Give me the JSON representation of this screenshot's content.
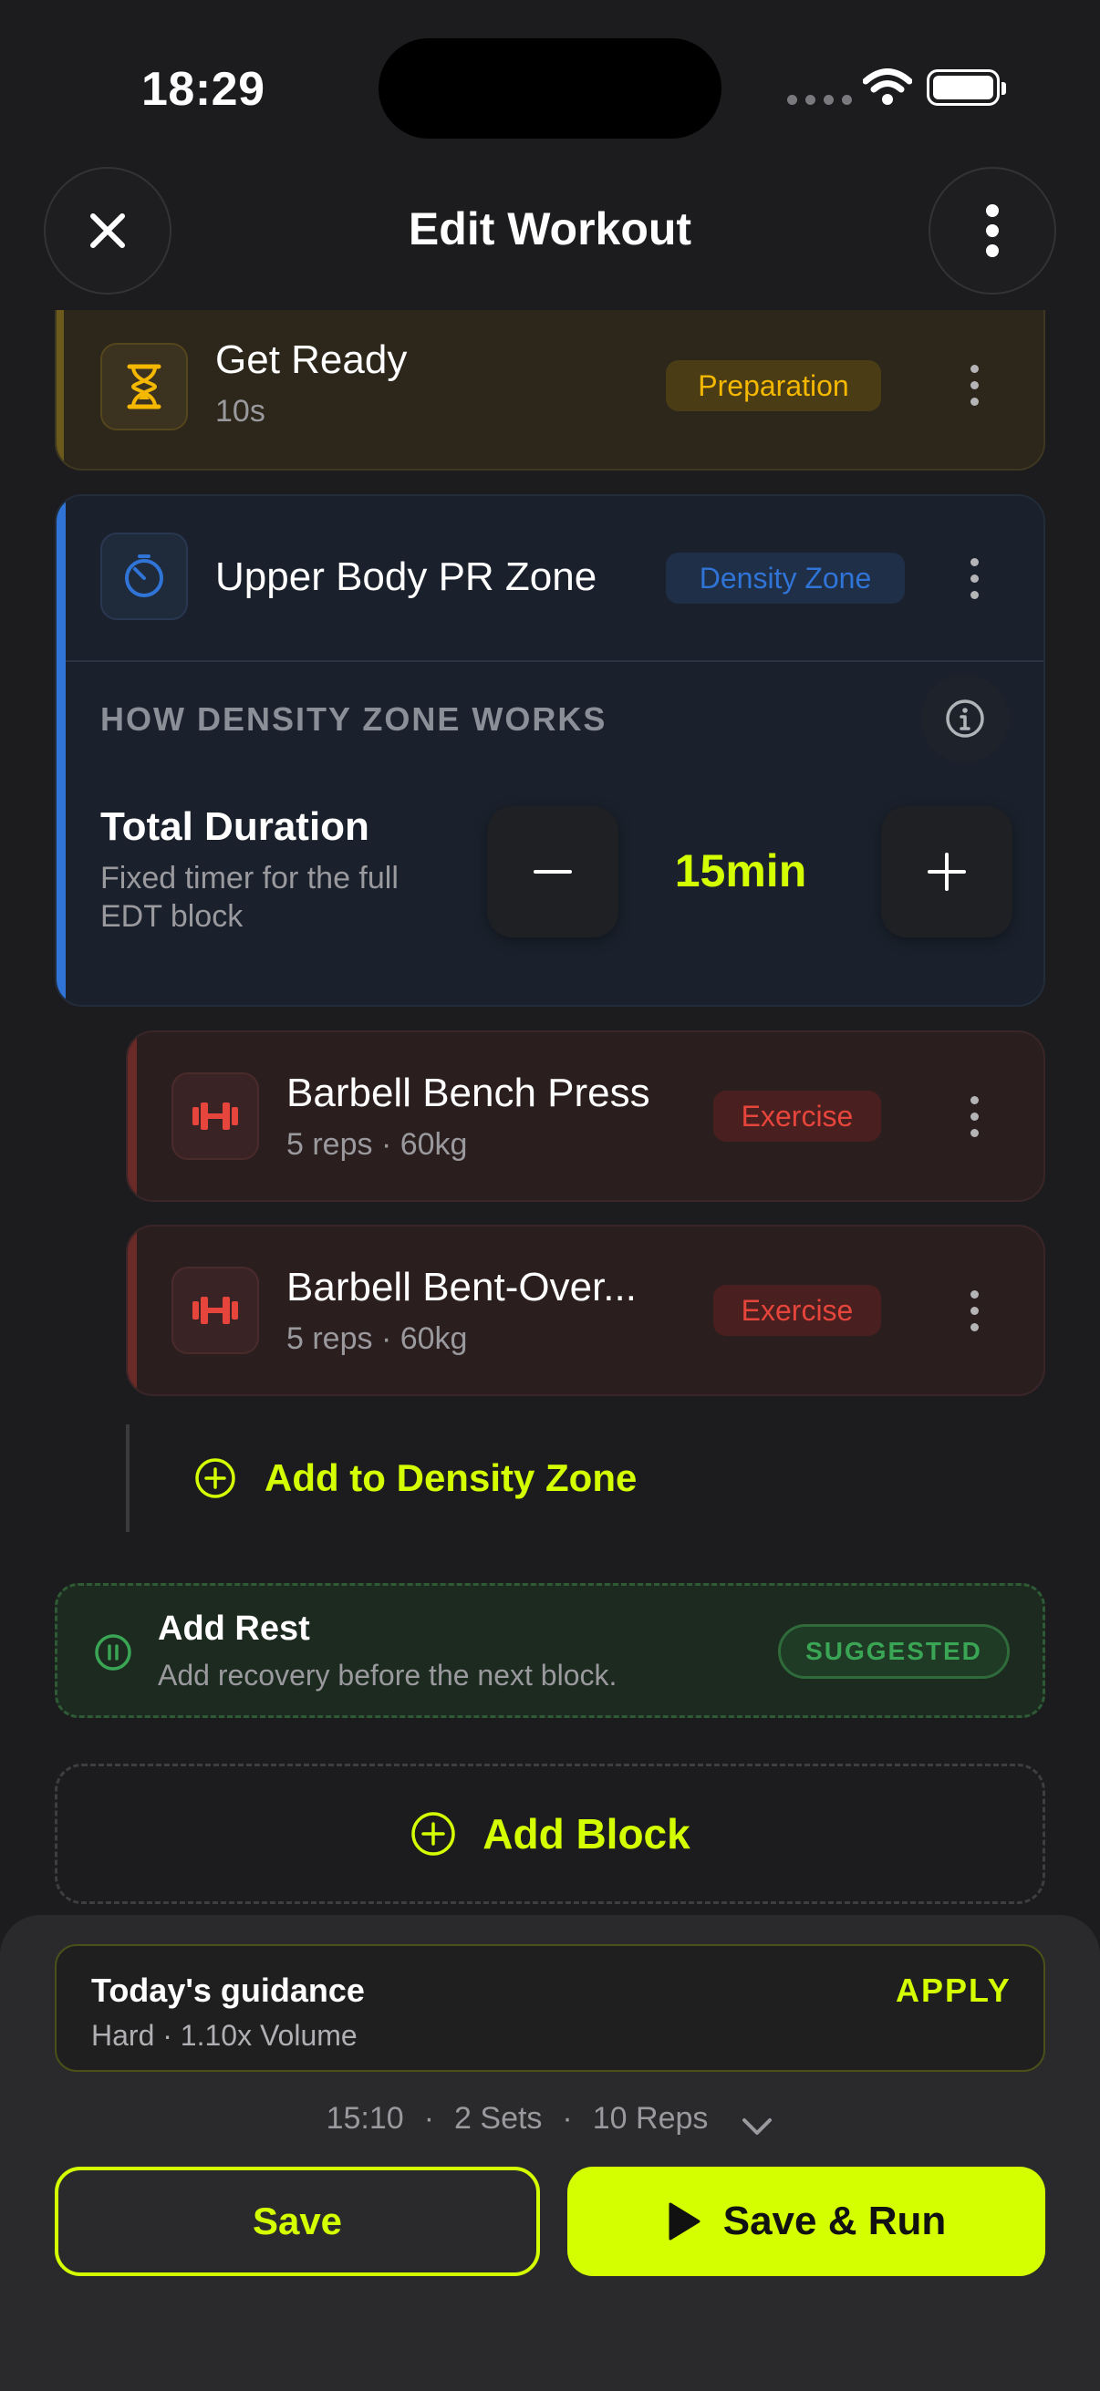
{
  "status_bar": {
    "time": "18:29"
  },
  "header": {
    "title": "Edit Workout"
  },
  "get_ready": {
    "title": "Get Ready",
    "subtitle": "10s",
    "badge": "Preparation"
  },
  "density_zone": {
    "title": "Upper Body PR Zone",
    "badge": "Density Zone",
    "section_label": "HOW DENSITY ZONE WORKS",
    "duration_label": "Total Duration",
    "duration_desc_line1": "Fixed timer for the full",
    "duration_desc_line2": "EDT block",
    "duration_value": "15min"
  },
  "exercises": [
    {
      "title": "Barbell Bench Press",
      "subtitle": "5 reps · 60kg",
      "badge": "Exercise"
    },
    {
      "title": "Barbell Bent-Over...",
      "subtitle": "5 reps · 60kg",
      "badge": "Exercise"
    }
  ],
  "add_to_zone_label": "Add to Density Zone",
  "add_rest": {
    "title": "Add Rest",
    "subtitle": "Add recovery before the next block.",
    "badge": "SUGGESTED"
  },
  "add_block_label": "Add Block",
  "guidance": {
    "title": "Today's guidance",
    "subtitle": "Hard · 1.10x Volume",
    "action": "APPLY"
  },
  "summary": {
    "time": "15:10",
    "sets": "2 Sets",
    "reps": "10 Reps",
    "separator": "·"
  },
  "buttons": {
    "save": "Save",
    "save_run": "Save & Run"
  },
  "colors": {
    "accent": "#d4ff00",
    "preparation": "#f5b800",
    "density": "#2f74d6",
    "exercise": "#e5453a",
    "rest": "#3aa655"
  },
  "icons": {
    "close": "close-icon",
    "more": "more-vertical-icon",
    "hourglass": "hourglass-icon",
    "timer": "timer-icon",
    "info": "info-icon",
    "dumbbell": "dumbbell-icon",
    "plus_circle": "plus-circle-icon",
    "pause_circle": "pause-circle-icon",
    "chevron": "chevron-down-icon",
    "play": "play-icon"
  }
}
